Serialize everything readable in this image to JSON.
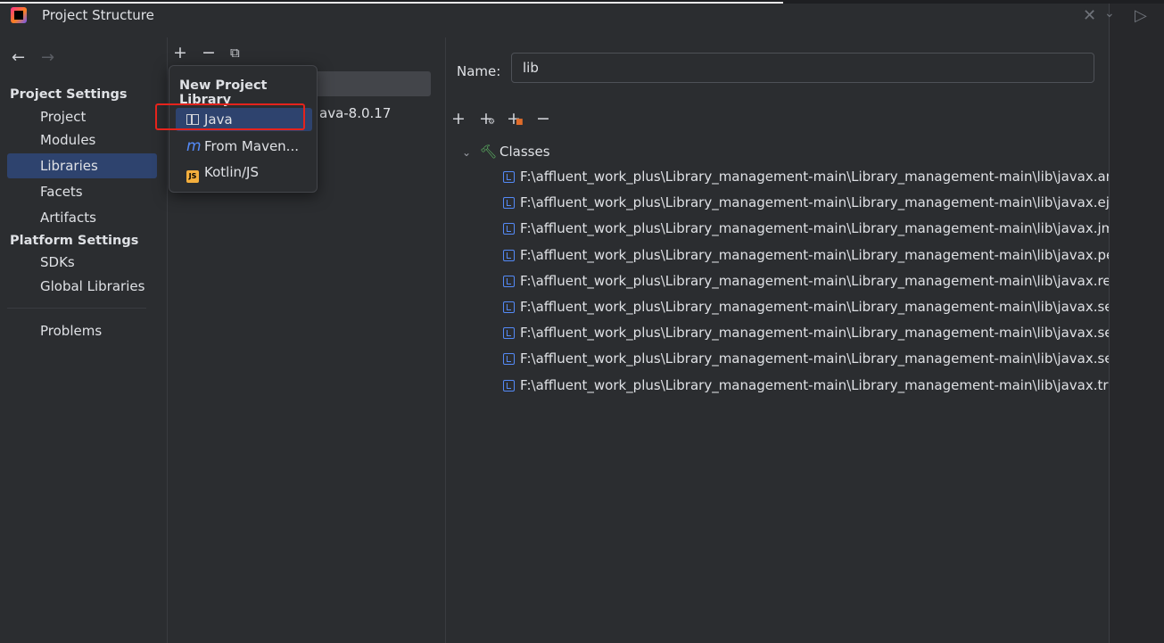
{
  "window": {
    "title": "Project Structure"
  },
  "icons": {
    "app": "intellij-logo-icon",
    "close": "close-icon",
    "back": "arrow-left-icon",
    "forward": "arrow-right-icon",
    "add": "plus-icon",
    "remove": "minus-icon",
    "copy": "copy-icon",
    "classes": "hammer-icon",
    "jar": "jar-icon"
  },
  "sidebar": {
    "project_settings_header": "Project Settings",
    "items": [
      "Project",
      "Modules",
      "Libraries",
      "Facets",
      "Artifacts"
    ],
    "selected": "Libraries",
    "platform_settings_header": "Platform Settings",
    "platform_items": [
      "SDKs",
      "Global Libraries"
    ],
    "problems": "Problems"
  },
  "middle": {
    "list_item_partial": "ava-8.0.17"
  },
  "popup": {
    "title": "New Project Library",
    "items": [
      "Java",
      "From Maven...",
      "Kotlin/JS"
    ],
    "selected": "Java"
  },
  "detail": {
    "name_label": "Name:",
    "name_value": "lib",
    "tree_root": "Classes",
    "classes": [
      "F:\\affluent_work_plus\\Library_management-main\\Library_management-main\\lib\\javax.annota",
      "F:\\affluent_work_plus\\Library_management-main\\Library_management-main\\lib\\javax.ejb.jar",
      "F:\\affluent_work_plus\\Library_management-main\\Library_management-main\\lib\\javax.jms.jar",
      "F:\\affluent_work_plus\\Library_management-main\\Library_management-main\\lib\\javax.persiste",
      "F:\\affluent_work_plus\\Library_management-main\\Library_management-main\\lib\\javax.resourc",
      "F:\\affluent_work_plus\\Library_management-main\\Library_management-main\\lib\\javax.servlet.",
      "F:\\affluent_work_plus\\Library_management-main\\Library_management-main\\lib\\javax.servlet.",
      "F:\\affluent_work_plus\\Library_management-main\\Library_management-main\\lib\\javax.servlet.",
      "F:\\affluent_work_plus\\Library_management-main\\Library_management-main\\lib\\javax.transac"
    ]
  },
  "colors": {
    "background": "#2b2d30",
    "selection": "#2e436e",
    "highlight_box": "#e5231c",
    "jar_icon": "#548af7",
    "hammer_icon": "#5fb865"
  }
}
